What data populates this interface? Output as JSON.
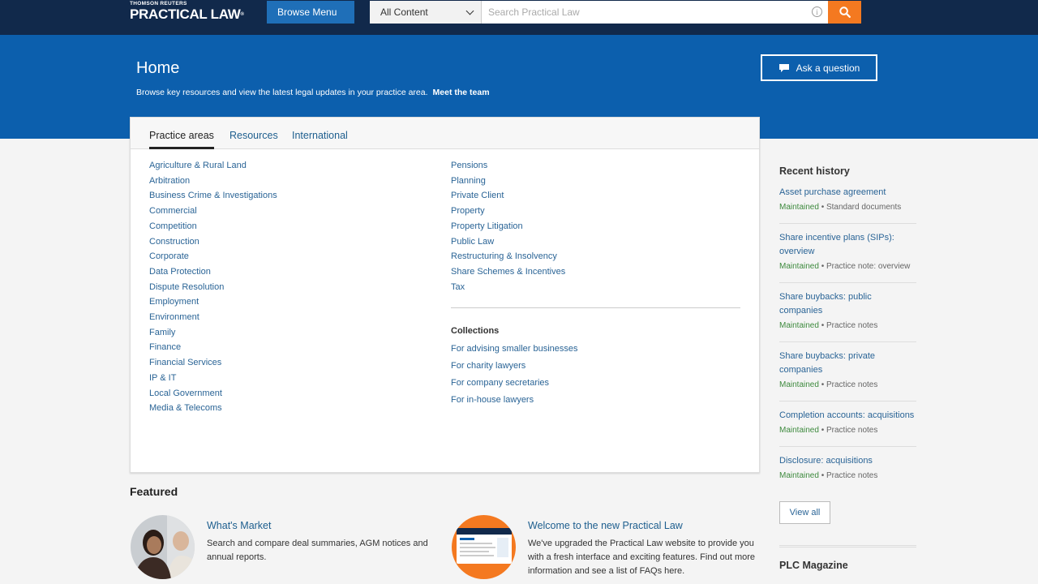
{
  "header": {
    "brand_small": "THOMSON REUTERS",
    "brand_big": "PRACTICAL LAW",
    "brand_tm": "®",
    "browse_menu": "Browse Menu",
    "content_select": "All Content",
    "search_placeholder": "Search Practical Law"
  },
  "hero": {
    "title": "Home",
    "subtitle": "Browse key resources and view the latest legal updates in your practice area.",
    "meet_team": "Meet the team",
    "ask_button": "Ask a question"
  },
  "tabs": [
    "Practice areas",
    "Resources",
    "International"
  ],
  "practice_areas_left": [
    "Agriculture & Rural Land",
    "Arbitration",
    "Business Crime & Investigations",
    "Commercial",
    "Competition",
    "Construction",
    "Corporate",
    "Data Protection",
    "Dispute Resolution",
    "Employment",
    "Environment",
    "Family",
    "Finance",
    "Financial Services",
    "IP & IT",
    "Local Government",
    "Media & Telecoms"
  ],
  "practice_areas_right": [
    "Pensions",
    "Planning",
    "Private Client",
    "Property",
    "Property Litigation",
    "Public Law",
    "Restructuring & Insolvency",
    "Share Schemes & Incentives",
    "Tax"
  ],
  "collections": {
    "title": "Collections",
    "items": [
      "For advising smaller businesses",
      "For charity lawyers",
      "For company secretaries",
      "For in-house lawyers"
    ]
  },
  "featured": {
    "title": "Featured",
    "items": [
      {
        "title": "What's Market",
        "text": "Search and compare deal summaries, AGM notices and annual reports."
      },
      {
        "title": "Welcome to the new Practical Law",
        "text": "We've upgraded the Practical Law website to provide you with a fresh interface and exciting features. Find out more information and see a list of FAQs here."
      }
    ]
  },
  "sidebar": {
    "title": "Recent history",
    "items": [
      {
        "title": "Asset purchase agreement",
        "status": "Maintained",
        "type": "Standard documents"
      },
      {
        "title": "Share incentive plans (SIPs): overview",
        "status": "Maintained",
        "type": "Practice note: overview"
      },
      {
        "title": "Share buybacks: public companies",
        "status": "Maintained",
        "type": "Practice notes"
      },
      {
        "title": "Share buybacks: private companies",
        "status": "Maintained",
        "type": "Practice notes"
      },
      {
        "title": "Completion accounts: acquisitions",
        "status": "Maintained",
        "type": "Practice notes"
      },
      {
        "title": "Disclosure: acquisitions",
        "status": "Maintained",
        "type": "Practice notes"
      }
    ],
    "view_all": "View all",
    "magazine_title": "PLC Magazine"
  },
  "colors": {
    "navy": "#11294b",
    "blue": "#0c5fad",
    "orange": "#f47920",
    "link": "#2a6496"
  }
}
